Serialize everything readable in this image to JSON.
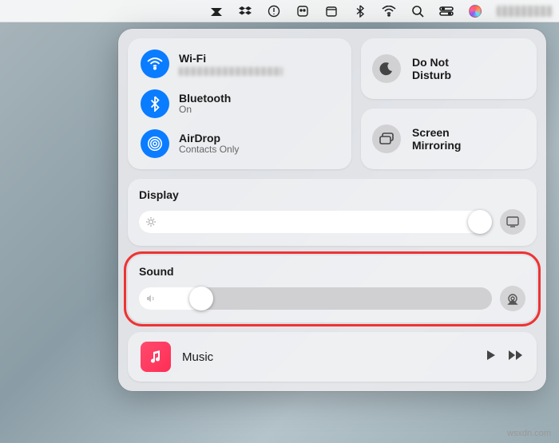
{
  "menubar": {
    "icons": [
      "app-a",
      "dropbox",
      "onepassword",
      "app-box",
      "today",
      "bluetooth",
      "wifi",
      "search",
      "control-center",
      "siri",
      "status-text"
    ]
  },
  "connectivity": {
    "wifi": {
      "title": "Wi-Fi",
      "sub_hidden": true
    },
    "bluetooth": {
      "title": "Bluetooth",
      "sub": "On"
    },
    "airdrop": {
      "title": "AirDrop",
      "sub": "Contacts Only"
    }
  },
  "dnd": {
    "title": "Do Not\nDisturb"
  },
  "mirroring": {
    "title": "Screen\nMirroring"
  },
  "display": {
    "label": "Display",
    "value_percent": 100
  },
  "sound": {
    "label": "Sound",
    "value_percent": 16
  },
  "music": {
    "title": "Music"
  },
  "watermark": "wsxdn.com"
}
